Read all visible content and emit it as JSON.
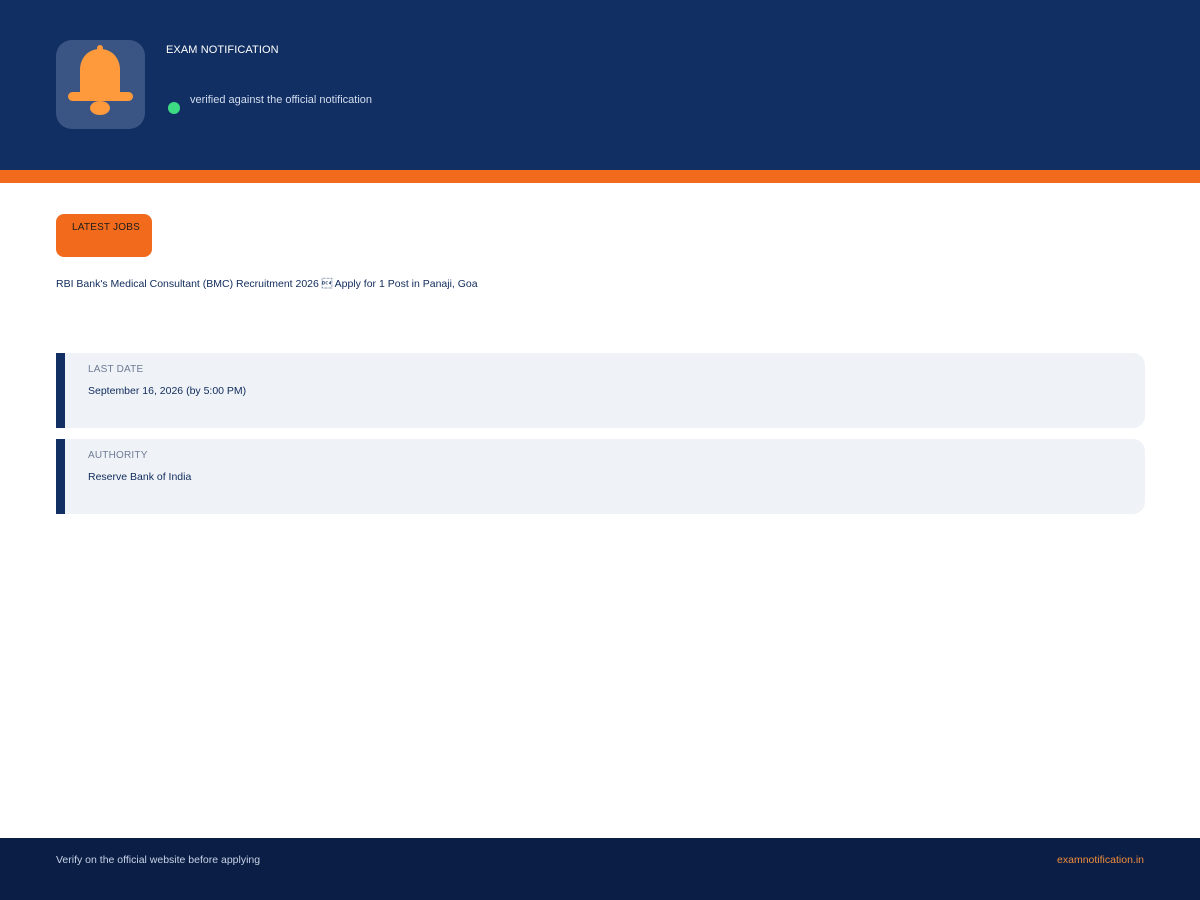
{
  "header": {
    "brand_label": "EXAM NOTIFICATION",
    "logo_icon": "bell-icon",
    "verify_text": "verified against the official notification",
    "verify_dot_color": "#3ddc84",
    "background_color": "#112f62",
    "accent_color": "#f26b1d"
  },
  "main": {
    "badge_label": "LATEST JOBS",
    "job_title": "RBI Bank's Medical Consultant (BMC) Recruitment 2026 \u0014 Apply for 1 Post in Panaji, Goa",
    "details": [
      {
        "label": "LAST DATE",
        "value": "September 16, 2026 (by 5:00 PM)"
      },
      {
        "label": "AUTHORITY",
        "value": "Reserve Bank of India"
      }
    ]
  },
  "footer": {
    "left_text": "Verify on the official website before applying",
    "right_text": "examnotification.in"
  }
}
